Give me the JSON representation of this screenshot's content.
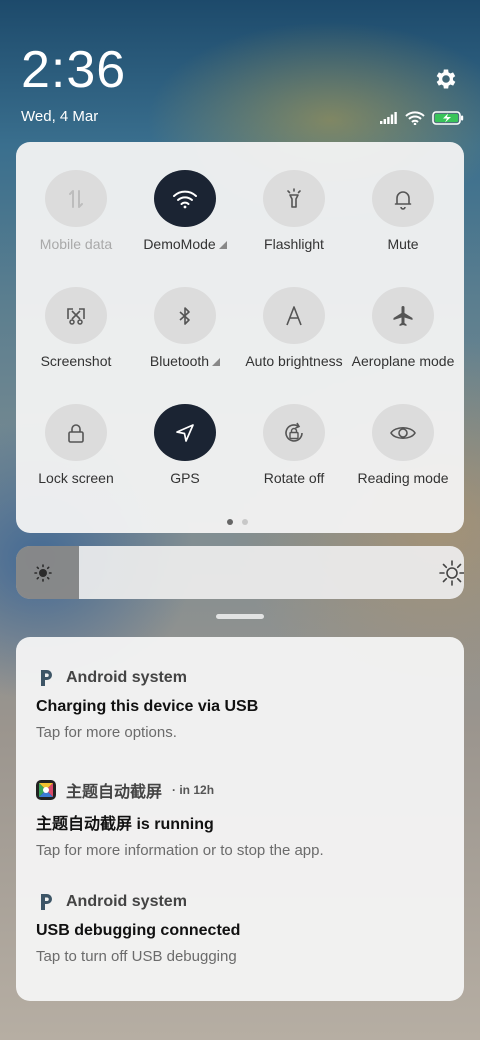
{
  "status": {
    "time": "2:36",
    "date": "Wed, 4 Mar",
    "icons": [
      "signal-icon",
      "wifi-icon",
      "battery-charging-icon"
    ]
  },
  "quick_settings": {
    "tiles": [
      {
        "label": "Mobile data",
        "icon": "mobile-data-icon",
        "state": "disabled"
      },
      {
        "label": "DemoMode",
        "icon": "wifi-icon",
        "state": "active",
        "expandable": true
      },
      {
        "label": "Flashlight",
        "icon": "flashlight-icon",
        "state": "inactive"
      },
      {
        "label": "Mute",
        "icon": "bell-icon",
        "state": "inactive"
      },
      {
        "label": "Screenshot",
        "icon": "screenshot-icon",
        "state": "inactive"
      },
      {
        "label": "Bluetooth",
        "icon": "bluetooth-icon",
        "state": "inactive",
        "expandable": true
      },
      {
        "label": "Auto brightness",
        "icon": "auto-brightness-icon",
        "state": "inactive"
      },
      {
        "label": "Aeroplane mode",
        "icon": "airplane-icon",
        "state": "inactive"
      },
      {
        "label": "Lock screen",
        "icon": "lock-icon",
        "state": "inactive"
      },
      {
        "label": "GPS",
        "icon": "location-arrow-icon",
        "state": "active"
      },
      {
        "label": "Rotate off",
        "icon": "rotate-lock-icon",
        "state": "inactive"
      },
      {
        "label": "Reading mode",
        "icon": "eye-icon",
        "state": "inactive"
      }
    ],
    "page_count": 2,
    "current_page": 1
  },
  "brightness": {
    "level": 0.14
  },
  "notifications": [
    {
      "app": "Android system",
      "icon": "android-system-icon",
      "time": "",
      "title": "Charging this device via USB",
      "body": "Tap for more options."
    },
    {
      "app": "主题自动截屏",
      "icon": "theme-app-icon",
      "time": "· in 12h",
      "title": "主题自动截屏 is running",
      "body": "Tap for more information or to stop the app."
    },
    {
      "app": "Android system",
      "icon": "android-system-icon",
      "time": "",
      "title": "USB debugging connected",
      "body": "Tap to turn off USB debugging"
    }
  ],
  "colors": {
    "active_tile": "#1b2433",
    "inactive_tile": "#dcdcdc",
    "battery_green": "#39c45a"
  }
}
